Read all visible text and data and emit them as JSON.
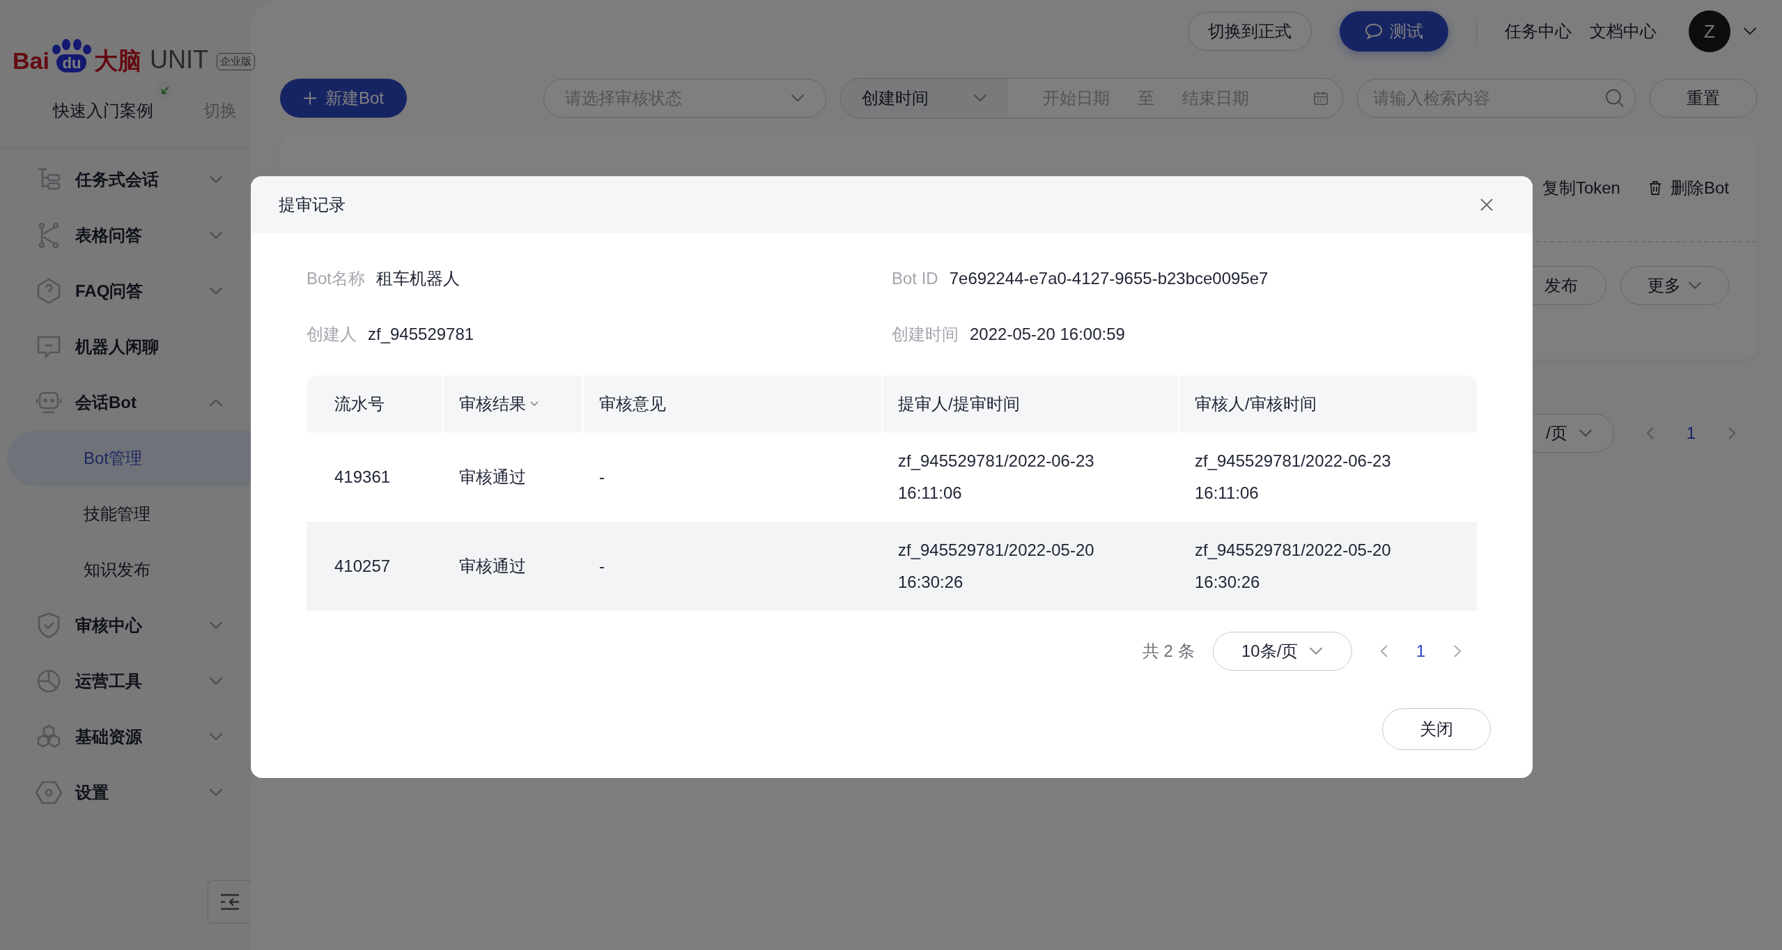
{
  "brand": {
    "name_part": "Bai",
    "paw_text": "du",
    "suffix": "大脑",
    "product": "UNIT",
    "edition": "企业版"
  },
  "sidebar": {
    "quick_start": "快速入门案例",
    "switch": "切换",
    "items": [
      {
        "kind": "group",
        "label": "任务式会话",
        "expanded": false
      },
      {
        "kind": "group",
        "label": "表格问答",
        "expanded": false
      },
      {
        "kind": "group",
        "label": "FAQ问答",
        "expanded": false
      },
      {
        "kind": "link",
        "label": "机器人闲聊"
      },
      {
        "kind": "group",
        "label": "会话Bot",
        "expanded": true,
        "children": [
          {
            "label": "Bot管理",
            "selected": true
          },
          {
            "label": "技能管理",
            "selected": false
          },
          {
            "label": "知识发布",
            "selected": false
          }
        ]
      },
      {
        "kind": "group",
        "label": "审核中心",
        "expanded": false
      },
      {
        "kind": "group",
        "label": "运营工具",
        "expanded": false
      },
      {
        "kind": "group",
        "label": "基础资源",
        "expanded": false
      },
      {
        "kind": "group",
        "label": "设置",
        "expanded": false
      }
    ]
  },
  "topbar": {
    "env_switch": "切换到正式",
    "test_button": "测试",
    "links": [
      "任务中心",
      "文档中心"
    ],
    "avatar": "Z"
  },
  "toolbar": {
    "new_button": "新建Bot",
    "status_select": {
      "placeholder": "请选择审核状态"
    },
    "date_type": "创建时间",
    "start_date": {
      "placeholder": "开始日期"
    },
    "range_separator": "至",
    "end_date": {
      "placeholder": "结束日期"
    },
    "search": {
      "placeholder": "请输入检索内容"
    },
    "reset": "重置"
  },
  "bot_card": {
    "actions": [
      "复制Token",
      "删除Bot"
    ],
    "buttons": [
      "发布",
      "更多"
    ]
  },
  "list_pagination": {
    "page_size": "/页",
    "pages": [
      {
        "label": "1",
        "selected": true
      }
    ]
  },
  "modal": {
    "title": "提审记录",
    "info": [
      {
        "label": "Bot名称",
        "value": "租车机器人"
      },
      {
        "label": "Bot ID",
        "value": "7e692244-e7a0-4127-9655-b23bce0095e7"
      },
      {
        "label": "创建人",
        "value": "zf_945529781"
      },
      {
        "label": "创建时间",
        "value": "2022-05-20 16:00:59"
      }
    ],
    "table": {
      "columns": [
        {
          "label": "流水号",
          "filterable": false
        },
        {
          "label": "审核结果",
          "filterable": true
        },
        {
          "label": "审核意见",
          "filterable": false
        },
        {
          "label": "提审人/提审时间",
          "filterable": false
        },
        {
          "label": "审核人/审核时间",
          "filterable": false
        }
      ],
      "rows": [
        {
          "hovered": false,
          "cells": [
            "419361",
            "审核通过",
            "-",
            "zf_945529781/2022-06-23 16:11:06",
            "zf_945529781/2022-06-23 16:11:06"
          ]
        },
        {
          "hovered": true,
          "cells": [
            "410257",
            "审核通过",
            "-",
            "zf_945529781/2022-05-20 16:30:26",
            "zf_945529781/2022-05-20 16:30:26"
          ]
        }
      ]
    },
    "pagination": {
      "total": "共 2 条",
      "page_size": "10条/页",
      "pages": [
        {
          "label": "1",
          "selected": true
        }
      ]
    },
    "close_button": "关闭"
  }
}
